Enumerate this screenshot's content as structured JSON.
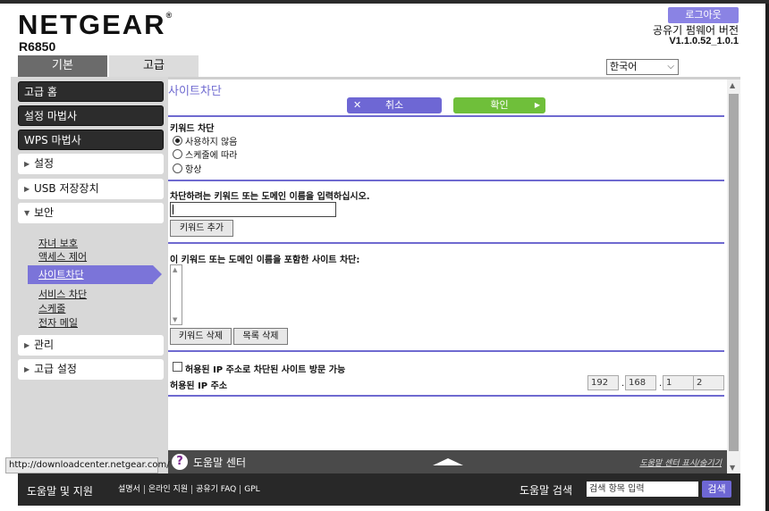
{
  "header": {
    "brand": "NETGEAR",
    "trademark": "®",
    "model": "R6850",
    "logout_label": "로그아웃",
    "firmware_label": "공유기 펌웨어 버전",
    "firmware_version": "V1.1.0.52_1.0.1",
    "language": "한국어",
    "tabs": [
      "기본",
      "고급"
    ],
    "active_tab": "고급"
  },
  "sidebar": {
    "dark_buttons": [
      "고급 홈",
      "설정 마법사",
      "WPS 마법사"
    ],
    "sections": [
      "설정",
      "USB 저장장치",
      "보안",
      "관리",
      "고급 설정"
    ],
    "security_items": [
      "자녀 보호",
      "액세스 제어",
      "사이트차단",
      "서비스 차단",
      "스케줄",
      "전자 메일"
    ],
    "active_item": "사이트차단"
  },
  "main": {
    "title": "사이트차단",
    "cancel_label": "취소",
    "ok_label": "확인",
    "keyword_block_label": "키워드 차단",
    "radio_options": [
      "사용하지 않음",
      "스케줄에 따라",
      "항상"
    ],
    "radio_selected": 0,
    "input_prompt": "차단하려는 키워드 또는 도메인 이름을 입력하십시오.",
    "keyword_input_value": "",
    "add_keyword_label": "키워드 추가",
    "list_label": "이 키워드 또는 도메인 이름을 포함한 사이트 차단:",
    "delete_keyword_label": "키워드 삭제",
    "clear_list_label": "목록 삭제",
    "allow_checkbox_label": "허용된 IP 주소로 차단된 사이트 방문 가능",
    "allow_checkbox_checked": false,
    "trusted_ip_label": "허용된 IP 주소",
    "ip": [
      "192",
      "168",
      "1",
      "2"
    ]
  },
  "helpbar": {
    "title": "도움말 센터",
    "toggle_label": "도움말 센터 표시/숨기기"
  },
  "status_url": "http://downloadcenter.netgear.com/",
  "footer": {
    "title": "도움말 및 지원",
    "links": [
      "설명서",
      "온라인 지원",
      "공유기 FAQ",
      "GPL"
    ],
    "search_label": "도움말 검색",
    "search_placeholder": "검색 항목 입력",
    "search_button": "검색"
  },
  "colors": {
    "accent_purple": "#6e67d4",
    "ok_green": "#6fbf3a",
    "sidebar_dark": "#2c2c2c",
    "footer_bg": "#282828"
  }
}
